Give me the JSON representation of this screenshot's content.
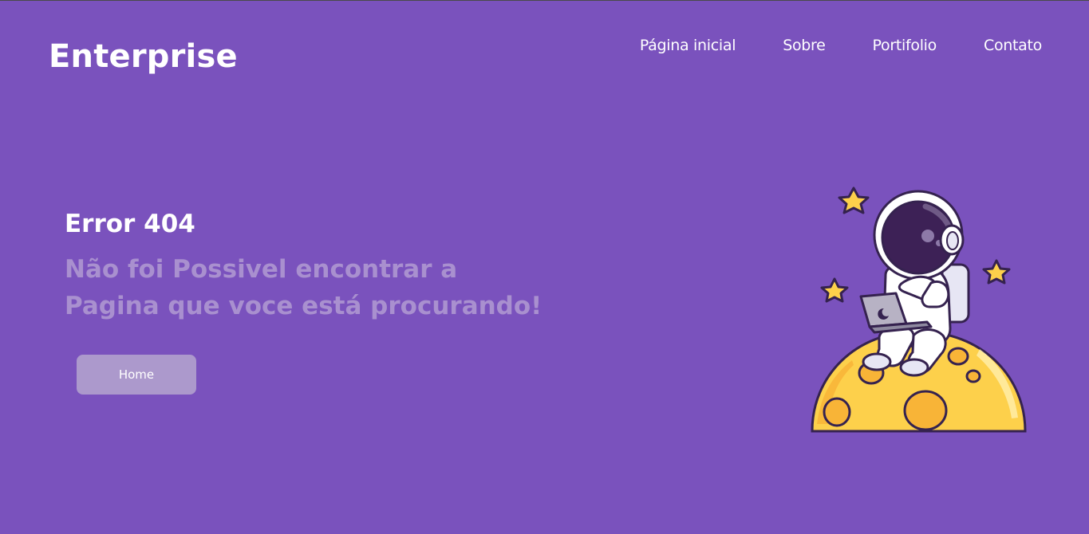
{
  "header": {
    "brand": "Enterprise",
    "nav": [
      {
        "label": "Página inicial"
      },
      {
        "label": "Sobre"
      },
      {
        "label": "Portifolio"
      },
      {
        "label": "Contato"
      }
    ]
  },
  "main": {
    "title": "Error 404",
    "message": "Não foi Possivel encontrar a Pagina que voce está procurando!",
    "home_button_label": "Home"
  },
  "illustration": {
    "subject": "astronaut-on-moon",
    "icons": [
      "star-icon",
      "astronaut-icon",
      "laptop-icon",
      "moon-icon"
    ]
  },
  "colors": {
    "background": "#7a52bd",
    "button": "#ac99cc",
    "message": "#a990cf",
    "text": "#ffffff"
  }
}
